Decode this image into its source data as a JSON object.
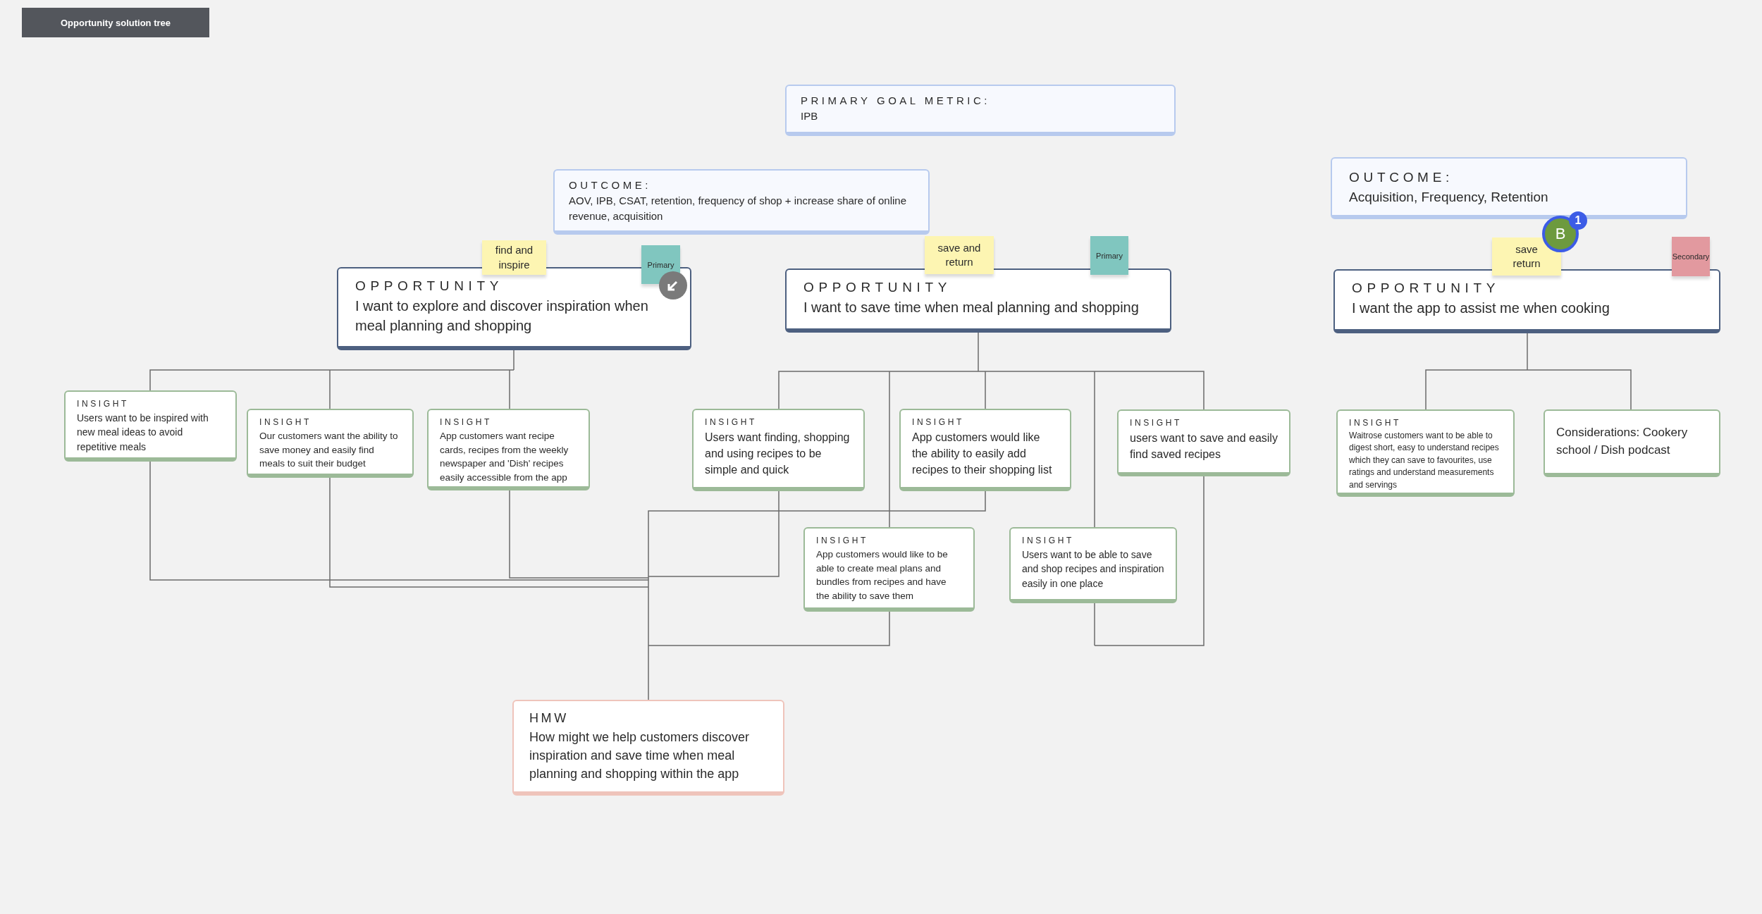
{
  "title": "Opportunity solution tree",
  "goal_metric": {
    "label": "PRIMARY GOAL METRIC:",
    "value": "IPB"
  },
  "outcomes": [
    {
      "label": "OUTCOME:",
      "text": "AOV, IPB, CSAT, retention, frequency of shop + increase share of online revenue, acquisition"
    },
    {
      "label": "OUTCOME:",
      "text": "Acquisition, Frequency, Retention"
    }
  ],
  "opportunities": [
    {
      "label": "OPPORTUNITY",
      "text": "I want to explore and discover inspiration when meal planning and shopping",
      "stickies": [
        {
          "kind": "tag",
          "lines": [
            "find and",
            "inspire"
          ],
          "color": "#fdf5b2"
        },
        {
          "kind": "priority",
          "lines": [
            "Primary"
          ],
          "color": "#80c6bf"
        }
      ]
    },
    {
      "label": "OPPORTUNITY",
      "text": "I want to save time when meal planning and shopping",
      "stickies": [
        {
          "kind": "tag",
          "lines": [
            "save and",
            "return"
          ],
          "color": "#fdf5b2"
        },
        {
          "kind": "priority",
          "lines": [
            "Primary"
          ],
          "color": "#80c6bf"
        }
      ]
    },
    {
      "label": "OPPORTUNITY",
      "text": "I want the app to assist me when cooking",
      "stickies": [
        {
          "kind": "tag",
          "lines": [
            "save",
            "return"
          ],
          "color": "#fdf5b2"
        },
        {
          "kind": "priority",
          "lines": [
            "Secondary"
          ],
          "color": "#e2999f"
        }
      ]
    }
  ],
  "comment_marker": {
    "initial": "B",
    "count": "1"
  },
  "insights": [
    {
      "label": "INSIGHT",
      "text": "Users want to be inspired with new meal ideas to avoid repetitive meals"
    },
    {
      "label": "INSIGHT",
      "text": "Our customers want the ability to save money and easily find meals to suit their budget"
    },
    {
      "label": "INSIGHT",
      "text": "App customers want recipe cards, recipes from the weekly newspaper and 'Dish' recipes easily accessible from the app"
    },
    {
      "label": "INSIGHT",
      "text": "Users want finding, shopping and using recipes to be simple and quick"
    },
    {
      "label": "INSIGHT",
      "text": "App customers would like the ability to easily add recipes to their shopping list"
    },
    {
      "label": "INSIGHT",
      "text": "users want to save and easily find saved recipes"
    },
    {
      "label": "INSIGHT",
      "text": "App customers would like to be able to create meal plans and bundles from recipes and have the ability to save them"
    },
    {
      "label": "INSIGHT",
      "text": "Users want to be able to save and shop recipes and inspiration easily in one place"
    },
    {
      "label": "INSIGHT",
      "text": "Waitrose customers want to be able to digest short, easy to understand recipes which they can save to favourites, use ratings and understand measurements and servings"
    }
  ],
  "considerations": {
    "text": "Considerations: Cookery school / Dish podcast"
  },
  "hmw": {
    "label": "HMW",
    "text": "How might we help customers discover inspiration and save time when meal planning and shopping within the app"
  }
}
